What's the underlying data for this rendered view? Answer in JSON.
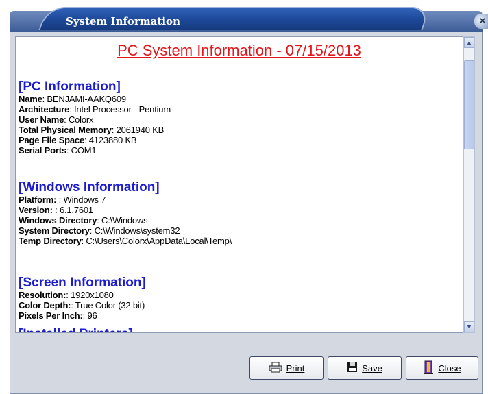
{
  "window": {
    "title": "System Information"
  },
  "document": {
    "title": "PC System Information - 07/15/2013",
    "sections": [
      {
        "heading": "[PC Information]",
        "rows": [
          {
            "key": "Name",
            "value": ": BENJAMI-AAKQ609"
          },
          {
            "key": "Architecture",
            "value": ": Intel Processor - Pentium"
          },
          {
            "key": "User Name",
            "value": ": Colorx"
          },
          {
            "key": "Total Physical Memory",
            "value": ": 2061940 KB"
          },
          {
            "key": "Page File Space",
            "value": ": 4123880 KB"
          },
          {
            "key": "Serial Ports",
            "value": ": COM1"
          }
        ]
      },
      {
        "heading": "[Windows Information]",
        "rows": [
          {
            "key": "Platform:",
            "value": " : Windows 7"
          },
          {
            "key": "Version:",
            "value": " : 6.1.7601"
          },
          {
            "key": "Windows Directory",
            "value": ": C:\\Windows"
          },
          {
            "key": "System Directory",
            "value": ": C:\\Windows\\system32"
          },
          {
            "key": "Temp Directory",
            "value": ": C:\\Users\\Colorx\\AppData\\Local\\Temp\\"
          }
        ]
      },
      {
        "heading": "[Screen Information]",
        "rows": [
          {
            "key": "Resolution:",
            "value": ": 1920x1080"
          },
          {
            "key": "Color Depth:",
            "value": ": True Color (32 bit)"
          },
          {
            "key": "Pixels Per Inch:",
            "value": ": 96"
          }
        ]
      }
    ],
    "cut_heading": "[Installed Printers]"
  },
  "buttons": {
    "print": "Print",
    "save": "Save",
    "close": "Close"
  },
  "icons": {
    "close_x": "close-icon",
    "print": "printer-icon",
    "save": "floppy-disk-icon",
    "close": "door-exit-icon"
  }
}
